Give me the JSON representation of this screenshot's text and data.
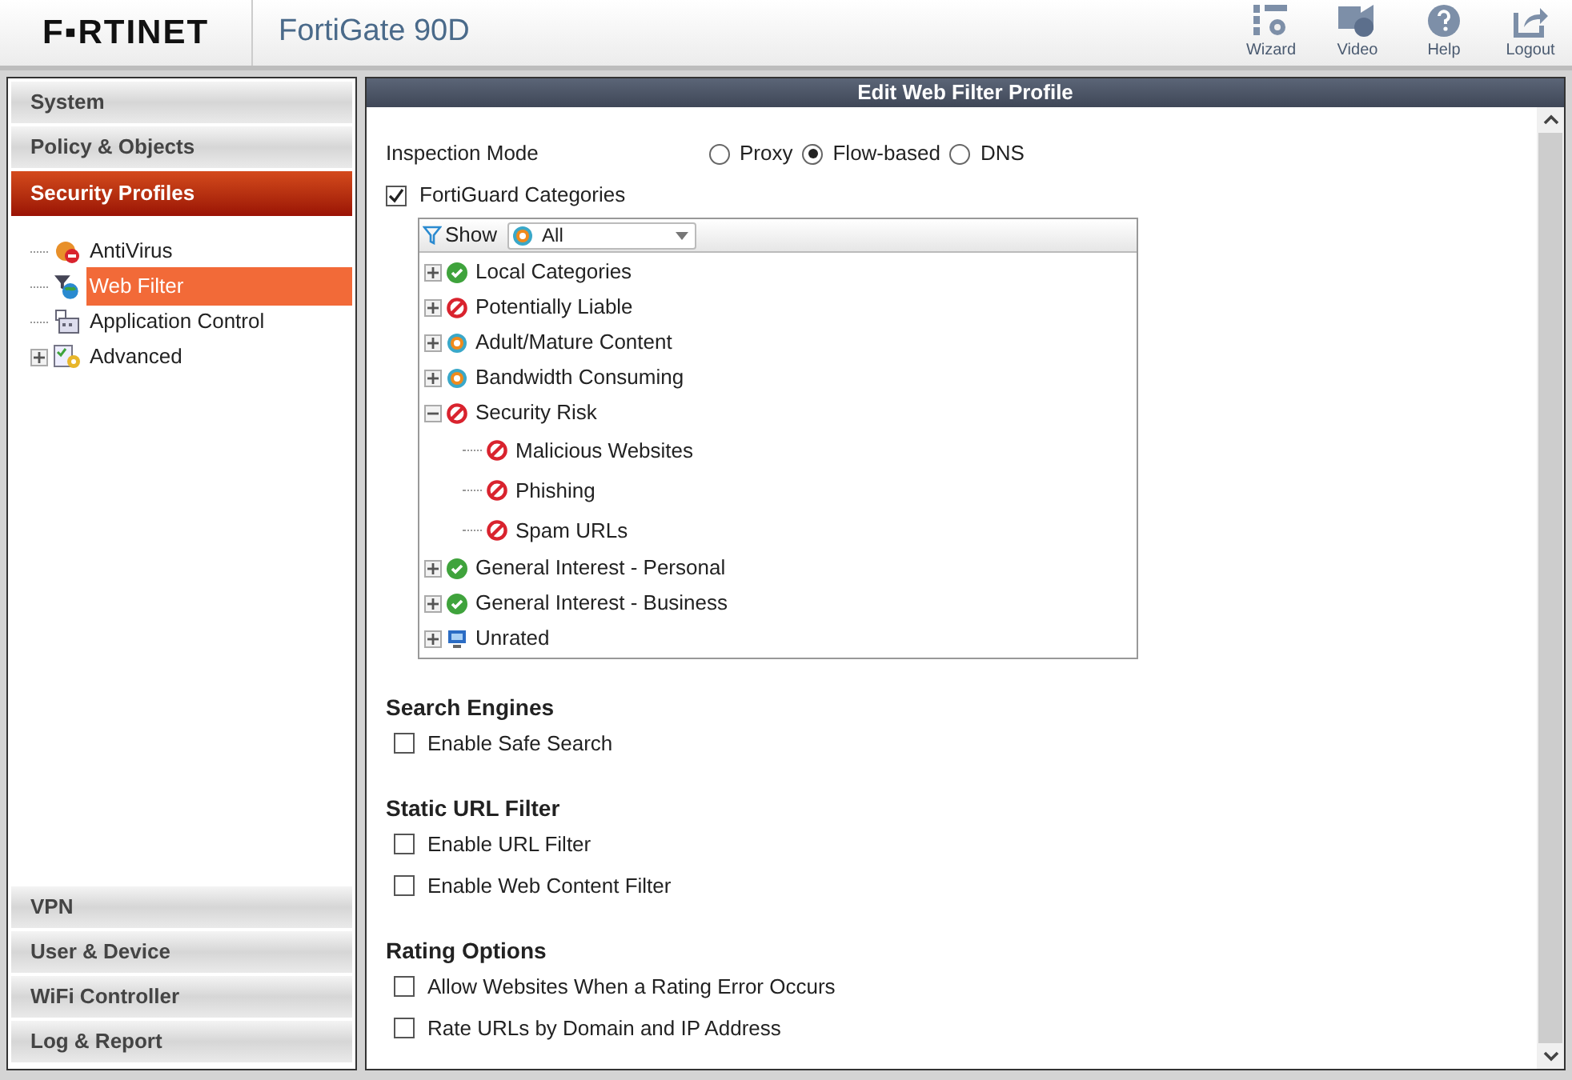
{
  "header": {
    "logo": "F▪RTINET",
    "title": "FortiGate 90D",
    "tools": [
      {
        "kind": "wizard",
        "label": "Wizard"
      },
      {
        "kind": "video",
        "label": "Video"
      },
      {
        "kind": "help",
        "label": "Help"
      },
      {
        "kind": "logout",
        "label": "Logout"
      }
    ]
  },
  "sidebar": {
    "top": [
      {
        "label": "System",
        "selected": false
      },
      {
        "label": "Policy & Objects",
        "selected": false
      },
      {
        "label": "Security Profiles",
        "selected": true
      }
    ],
    "items": [
      {
        "kind": "antivirus",
        "label": "AntiVirus",
        "selected": false,
        "expandable": false
      },
      {
        "kind": "webfilter",
        "label": "Web Filter",
        "selected": true,
        "expandable": false
      },
      {
        "kind": "appcontrol",
        "label": "Application Control",
        "selected": false,
        "expandable": false
      },
      {
        "kind": "advanced",
        "label": "Advanced",
        "selected": false,
        "expandable": true
      }
    ],
    "bottom": [
      {
        "label": "VPN",
        "selected": false
      },
      {
        "label": "User & Device",
        "selected": false
      },
      {
        "label": "WiFi Controller",
        "selected": false
      },
      {
        "label": "Log & Report",
        "selected": false
      }
    ]
  },
  "panel": {
    "title": "Edit Web Filter Profile",
    "inspection_label": "Inspection Mode",
    "modes": [
      {
        "label": "Proxy",
        "selected": false
      },
      {
        "label": "Flow-based",
        "selected": true
      },
      {
        "label": "DNS",
        "selected": false
      }
    ],
    "fortiguard": {
      "label": "FortiGuard Categories",
      "checked": true,
      "show_label": "Show",
      "filter_value": "All",
      "categories": [
        {
          "label": "Local Categories",
          "kind": "allow",
          "expanded": false
        },
        {
          "label": "Potentially Liable",
          "kind": "block",
          "expanded": false
        },
        {
          "label": "Adult/Mature Content",
          "kind": "monitor",
          "expanded": false
        },
        {
          "label": "Bandwidth Consuming",
          "kind": "monitor",
          "expanded": false
        },
        {
          "label": "Security Risk",
          "kind": "block",
          "expanded": true,
          "children": [
            {
              "label": "Malicious Websites",
              "kind": "block"
            },
            {
              "label": "Phishing",
              "kind": "block"
            },
            {
              "label": "Spam URLs",
              "kind": "block"
            }
          ]
        },
        {
          "label": "General Interest - Personal",
          "kind": "allow",
          "expanded": false
        },
        {
          "label": "General Interest - Business",
          "kind": "allow",
          "expanded": false
        },
        {
          "label": "Unrated",
          "kind": "unrated",
          "expanded": false
        }
      ]
    },
    "sections": [
      {
        "title": "Search Engines",
        "options": [
          {
            "label": "Enable Safe Search",
            "checked": false
          }
        ]
      },
      {
        "title": "Static URL Filter",
        "options": [
          {
            "label": "Enable URL Filter",
            "checked": false
          },
          {
            "label": "Enable Web Content Filter",
            "checked": false
          }
        ]
      },
      {
        "title": "Rating Options",
        "options": [
          {
            "label": "Allow Websites When a Rating Error Occurs",
            "checked": false
          },
          {
            "label": "Rate URLs by Domain and IP Address",
            "checked": false
          }
        ]
      }
    ]
  }
}
